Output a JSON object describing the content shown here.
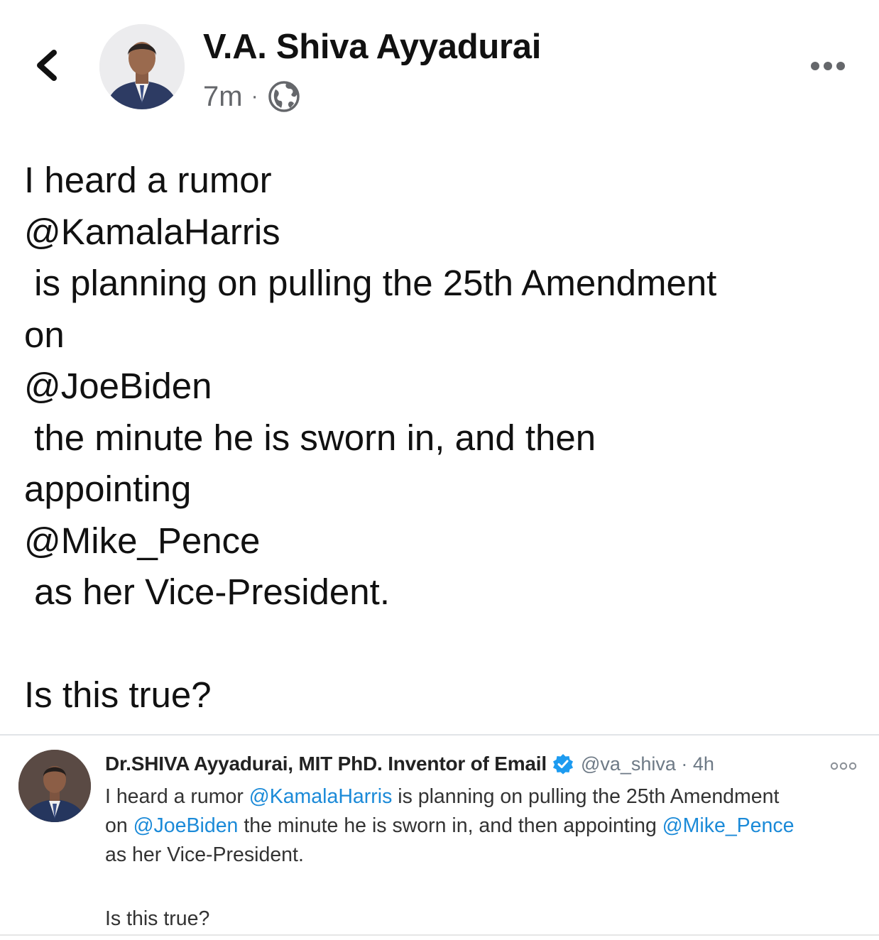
{
  "header": {
    "author_name": "V.A. Shiva Ayyadurai",
    "timestamp": "7m",
    "separator": "·",
    "back_icon": "chevron-left-icon",
    "privacy_icon": "globe-icon",
    "more_icon": "more-horizontal-icon"
  },
  "post": {
    "lines": [
      "I heard a rumor",
      "@KamalaHarris",
      " is planning on pulling the 25th Amendment",
      "on",
      "@JoeBiden",
      " the minute he is sworn in, and then",
      "appointing",
      "@Mike_Pence",
      " as her Vice-President.",
      "",
      "Is this true?"
    ]
  },
  "embedded_tweet": {
    "display_name": "Dr.SHIVA Ayyadurai, MIT PhD. Inventor of Email",
    "verified_icon": "verified-badge-icon",
    "handle_time": "@va_shiva · 4h",
    "more_icon": "more-horizontal-icon",
    "body": {
      "t1": "I heard a rumor ",
      "m1": "@KamalaHarris",
      "t2": " is planning on pulling the 25th Amendment",
      "t3": "on ",
      "m2": "@JoeBiden",
      "t4": " the minute he is sworn in, and then appointing ",
      "m3": "@Mike_Pence",
      "t5": "as her Vice-President.",
      "t6": "Is this true?"
    }
  },
  "colors": {
    "text": "#111111",
    "meta_gray": "#65676b",
    "mention_blue": "#1b8ad8",
    "verified_blue": "#1d9bf0"
  }
}
